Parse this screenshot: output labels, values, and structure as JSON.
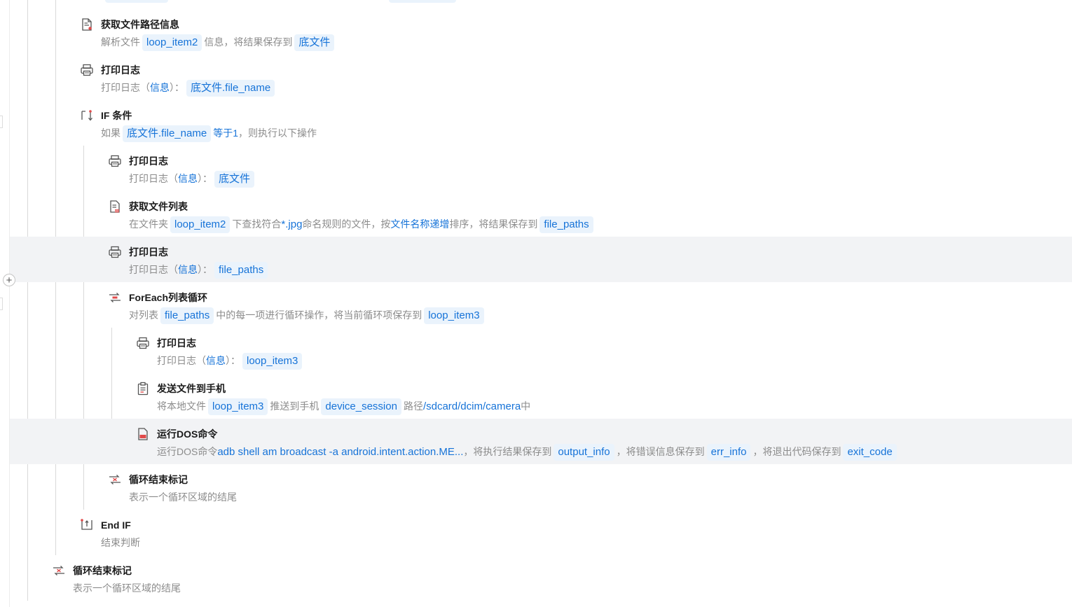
{
  "colors": {
    "accent": "#1673d8",
    "tag_bg": "#eaf3fc",
    "row_highlight": "#f2f3f5"
  },
  "steps": [
    {
      "icon": "file-path-icon",
      "title": "获取文件路径信息",
      "desc": {
        "p1": "解析文件",
        "v1": "loop_item2",
        "p2": "信息，将结果保存到",
        "v2": "底文件"
      }
    },
    {
      "icon": "printer-icon",
      "title": "打印日志",
      "desc": {
        "p1": "打印日志（",
        "k1": "信息",
        "p2": "）：",
        "v1": "底文件.file_name"
      }
    },
    {
      "icon": "if-branch-icon",
      "title": "IF 条件",
      "desc": {
        "p1": "如果",
        "v1": "底文件.file_name",
        "k1": "等于1",
        "p2": "，则执行以下操作"
      }
    },
    {
      "icon": "printer-icon",
      "title": "打印日志",
      "desc": {
        "p1": "打印日志（",
        "k1": "信息",
        "p2": "）：",
        "v1": "底文件"
      }
    },
    {
      "icon": "file-list-icon",
      "title": "获取文件列表",
      "desc": {
        "p1": "在文件夹",
        "v1": "loop_item2",
        "p2": "下查找符合",
        "k1": "*.jpg",
        "p3": "命名规则的文件，按",
        "k2": "文件名称递增",
        "p4": "排序，将结果保存到",
        "v2": "file_paths"
      }
    },
    {
      "icon": "printer-icon",
      "title": "打印日志",
      "desc": {
        "p1": "打印日志（",
        "k1": "信息",
        "p2": "）：",
        "v1": "file_paths"
      }
    },
    {
      "icon": "foreach-loop-icon",
      "title": "ForEach列表循环",
      "desc": {
        "p1": "对列表",
        "v1": "file_paths",
        "p2": "中的每一项进行循环操作，将当前循环项保存到",
        "v2": "loop_item3"
      }
    },
    {
      "icon": "printer-icon",
      "title": "打印日志",
      "desc": {
        "p1": "打印日志（",
        "k1": "信息",
        "p2": "）：",
        "v1": "loop_item3"
      }
    },
    {
      "icon": "clipboard-icon",
      "title": "发送文件到手机",
      "desc": {
        "p1": "将本地文件",
        "v1": "loop_item3",
        "p2": "推送到手机",
        "v2": "device_session",
        "p3": "路径",
        "k1": "/sdcard/dcim/camera",
        "p4": "中"
      }
    },
    {
      "icon": "dos-command-icon",
      "title": "运行DOS命令",
      "desc": {
        "p1": "运行DOS命令",
        "k1": "adb shell am broadcast -a android.intent.action.ME...",
        "p2": "，将执行结果保存到",
        "v1": "output_info",
        "p3": "，将错误信息保存到",
        "v2": "err_info",
        "p4": "，将退出代码保存到",
        "v3": "exit_code"
      }
    },
    {
      "icon": "loop-end-icon",
      "title": "循环结束标记",
      "desc": {
        "p1": "表示一个循环区域的结尾"
      }
    },
    {
      "icon": "end-if-icon",
      "title": "End IF",
      "desc": {
        "p1": "结束判断"
      }
    },
    {
      "icon": "loop-end-icon",
      "title": "循环结束标记",
      "desc": {
        "p1": "表示一个循环区域的结尾"
      }
    }
  ],
  "add_button": "+"
}
